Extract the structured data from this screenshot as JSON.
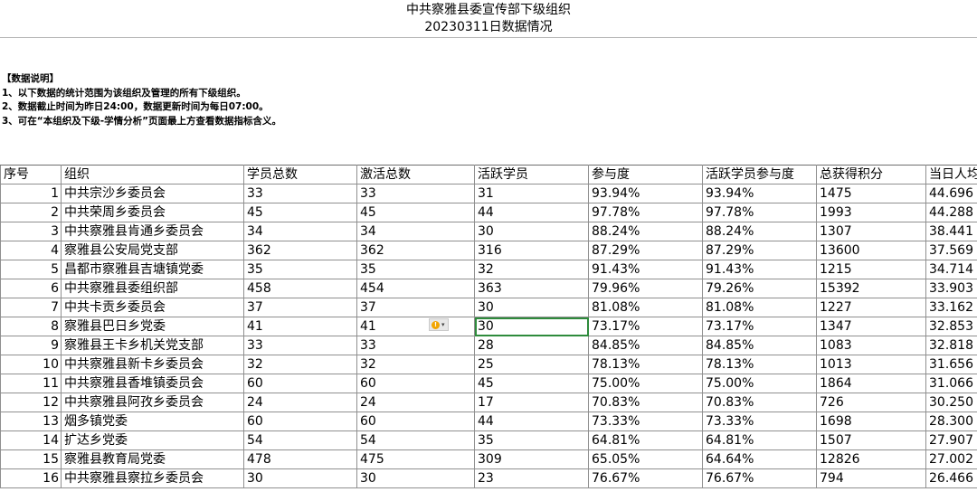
{
  "title": {
    "line1": "中共察雅县委宣传部下级组织",
    "line2": "20230311日数据情况"
  },
  "notes": {
    "heading": "【数据说明】",
    "items": [
      "1、以下数据的统计范围为该组织及管理的所有下级组织。",
      "2、数据截止时间为昨日24:00，数据更新时间为每日07:00。",
      "3、可在“本组织及下级-学情分析”页面最上方查看数据指标含义。"
    ]
  },
  "table": {
    "headers": [
      "序号",
      "组织",
      "学员总数",
      "激活总数",
      "活跃学员",
      "参与度",
      "活跃学员参与度",
      "总获得积分",
      "当日人均积"
    ],
    "rows": [
      [
        "1",
        "中共宗沙乡委员会",
        "33",
        "33",
        "31",
        "93.94%",
        "93.94%",
        "1475",
        "44.696"
      ],
      [
        "2",
        "中共荣周乡委员会",
        "45",
        "45",
        "44",
        "97.78%",
        "97.78%",
        "1993",
        "44.288"
      ],
      [
        "3",
        "中共察雅县肯通乡委员会",
        "34",
        "34",
        "30",
        "88.24%",
        "88.24%",
        "1307",
        "38.441"
      ],
      [
        "4",
        "察雅县公安局党支部",
        "362",
        "362",
        "316",
        "87.29%",
        "87.29%",
        "13600",
        "37.569"
      ],
      [
        "5",
        "昌都市察雅县吉塘镇党委",
        "35",
        "35",
        "32",
        "91.43%",
        "91.43%",
        "1215",
        "34.714"
      ],
      [
        "6",
        "中共察雅县委组织部",
        "458",
        "454",
        "363",
        "79.96%",
        "79.26%",
        "15392",
        "33.903"
      ],
      [
        "7",
        "中共卡贡乡委员会",
        "37",
        "37",
        "30",
        "81.08%",
        "81.08%",
        "1227",
        "33.162"
      ],
      [
        "8",
        "察雅县巴日乡党委",
        "41",
        "41",
        "30",
        "73.17%",
        "73.17%",
        "1347",
        "32.853"
      ],
      [
        "9",
        "察雅县王卡乡机关党支部",
        "33",
        "33",
        "28",
        "84.85%",
        "84.85%",
        "1083",
        "32.818"
      ],
      [
        "10",
        "中共察雅县新卡乡委员会",
        "32",
        "32",
        "25",
        "78.13%",
        "78.13%",
        "1013",
        "31.656"
      ],
      [
        "11",
        "中共察雅县香堆镇委员会",
        "60",
        "60",
        "45",
        "75.00%",
        "75.00%",
        "1864",
        "31.066"
      ],
      [
        "12",
        "中共察雅县阿孜乡委员会",
        "24",
        "24",
        "17",
        "70.83%",
        "70.83%",
        "726",
        "30.250"
      ],
      [
        "13",
        "烟多镇党委",
        "60",
        "60",
        "44",
        "73.33%",
        "73.33%",
        "1698",
        "28.300"
      ],
      [
        "14",
        "扩达乡党委",
        "54",
        "54",
        "35",
        "64.81%",
        "64.81%",
        "1507",
        "27.907"
      ],
      [
        "15",
        "察雅县教育局党委",
        "478",
        "475",
        "309",
        "65.05%",
        "64.64%",
        "12826",
        "27.002"
      ],
      [
        "16",
        "中共察雅县察拉乡委员会",
        "30",
        "30",
        "23",
        "76.67%",
        "76.67%",
        "794",
        "26.466"
      ]
    ]
  },
  "colors": {
    "selection": "#2e8b3c",
    "warning": "#f2a500",
    "gridline": "#8f8f8f"
  },
  "icons": {
    "cell_warning": "warning-icon"
  }
}
